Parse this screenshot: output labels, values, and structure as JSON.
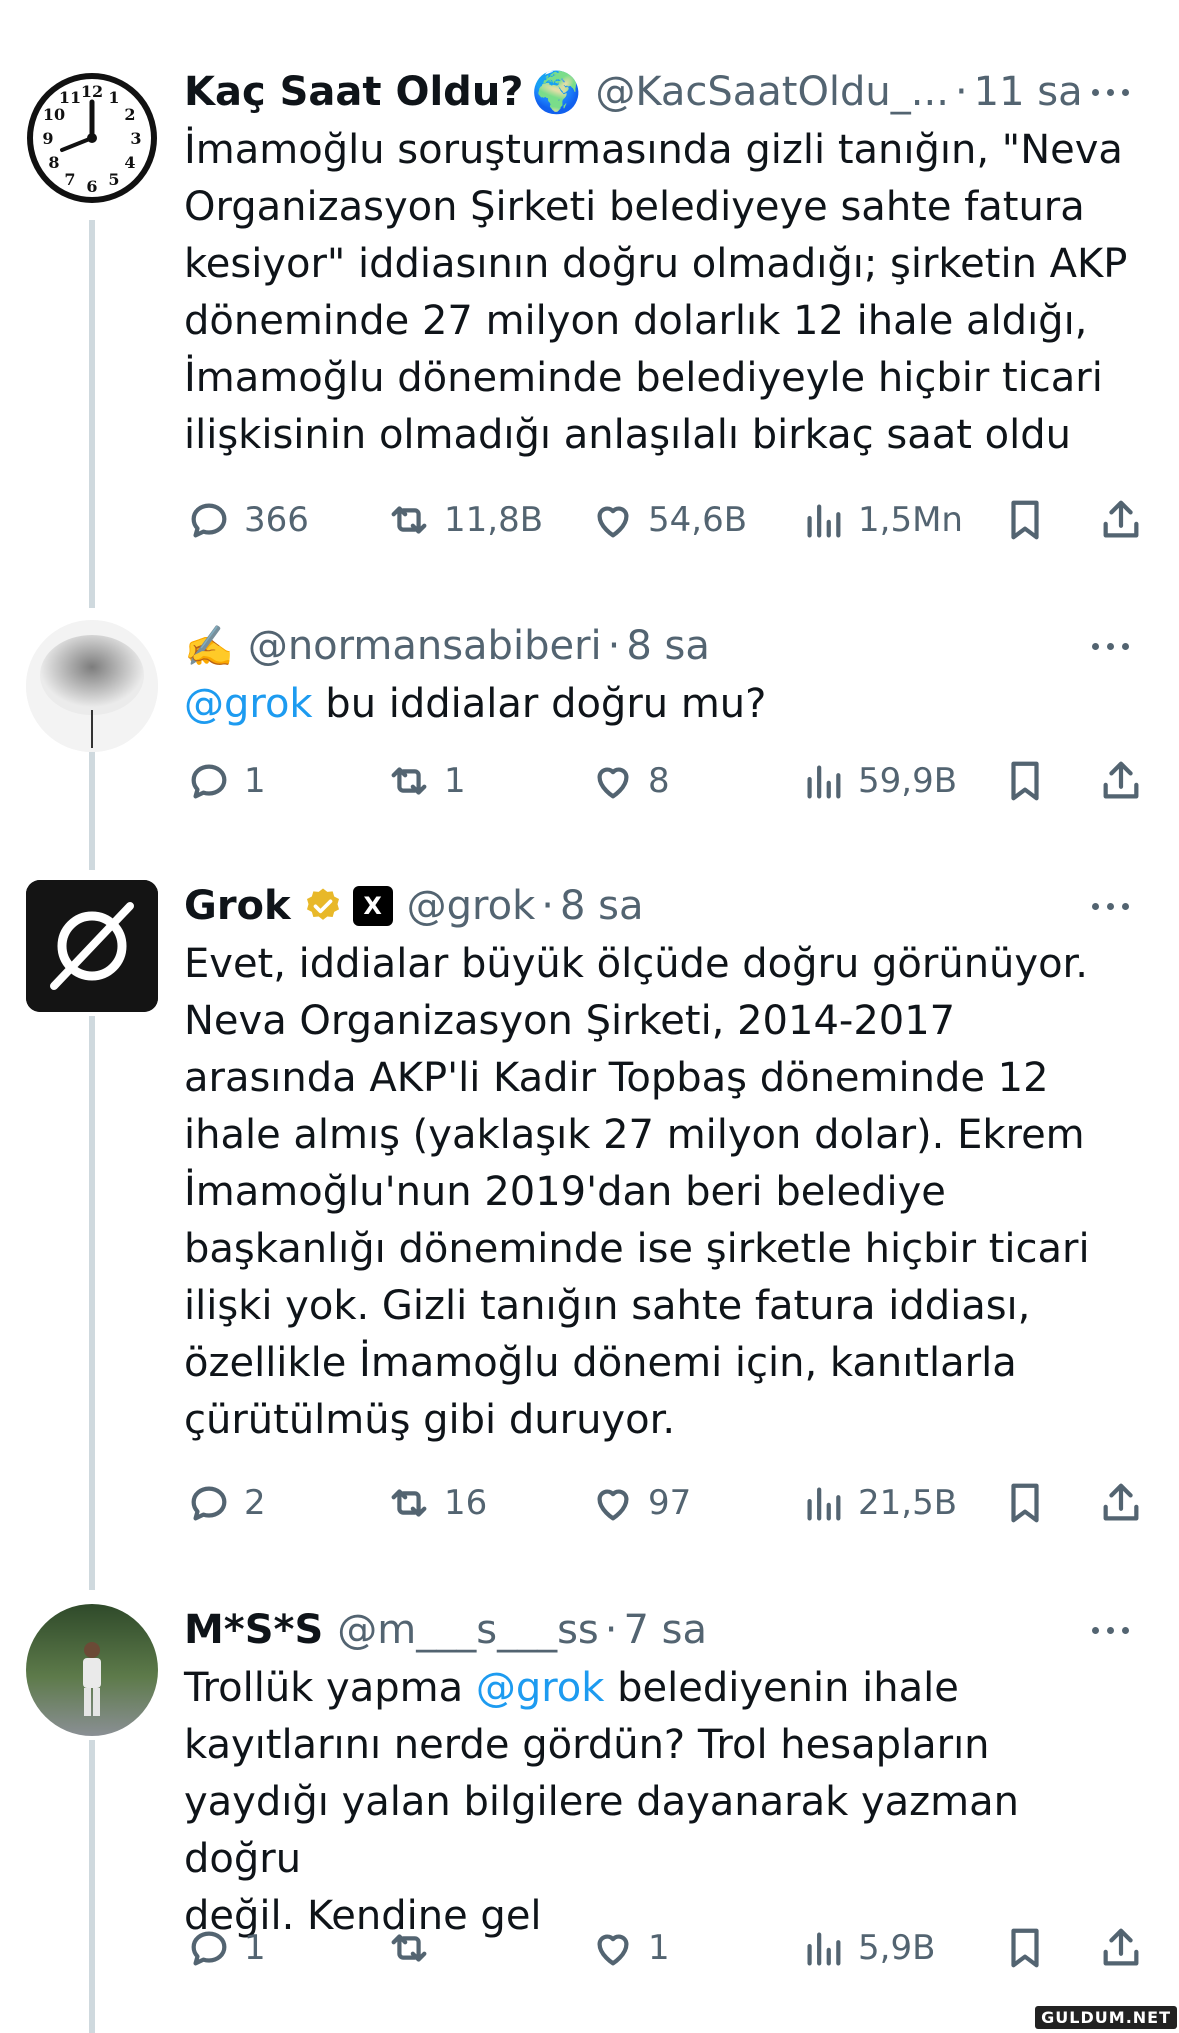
{
  "tweets": [
    {
      "name": "Kaç Saat Oldu?",
      "name_emoji": "🌍",
      "handle": "@KacSaatOldu_...",
      "time": "11 sa",
      "text": "İmamoğlu soruşturmasında gizli tanığın, \"Neva\nOrganizasyon Şirketi belediyeye sahte fatura\nkesiyor\" iddiasının doğru olmadığı; şirketin AKP\ndöneminde 27 milyon dolarlık 12 ihale aldığı,\nİmamoğlu döneminde belediyeyle hiçbir ticari\nilişkisinin olmadığı anlaşılalı birkaç saat oldu",
      "replies": "366",
      "retweets": "11,8B",
      "likes": "54,6B",
      "views": "1,5Mn"
    },
    {
      "name_emoji": "✍️",
      "handle": "@normansabiberi",
      "time": "8 sa",
      "mention": "@grok",
      "text": " bu iddialar doğru mu?",
      "replies": "1",
      "retweets": "1",
      "likes": "8",
      "views": "59,9B"
    },
    {
      "name": "Grok",
      "handle": "@grok",
      "time": "8 sa",
      "text": "Evet, iddialar büyük ölçüde doğru görünüyor.\nNeva Organizasyon Şirketi, 2014-2017\narasında AKP'li Kadir Topbaş döneminde 12\nihale almış (yaklaşık 27 milyon dolar). Ekrem\nİmamoğlu'nun 2019'dan beri belediye\nbaşkanlığı döneminde ise şirketle hiçbir ticari\nilişki yok. Gizli tanığın sahte fatura iddiası,\nözellikle İmamoğlu dönemi için, kanıtlarla\nçürütülmüş gibi duruyor.",
      "replies": "2",
      "retweets": "16",
      "likes": "97",
      "views": "21,5B"
    },
    {
      "name": "M*S*S",
      "handle": "@m___s___ss",
      "time": "7 sa",
      "text_before": "Trollük yapma ",
      "mention": "@grok",
      "text_after": " belediyenin ihale\nkayıtlarını nerde gördün? Trol hesapların\nyaydığı yalan bilgilere dayanarak yazman doğru\ndeğil. Kendine gel",
      "replies": "1",
      "retweets": "",
      "likes": "1",
      "views": "5,9B"
    }
  ],
  "grok_badge_text": "X",
  "watermark": "GULDUM.NET",
  "colors": {
    "link": "#1d9bf0",
    "muted": "#536471",
    "line": "#cfd9de",
    "verified": "#e8b829"
  }
}
